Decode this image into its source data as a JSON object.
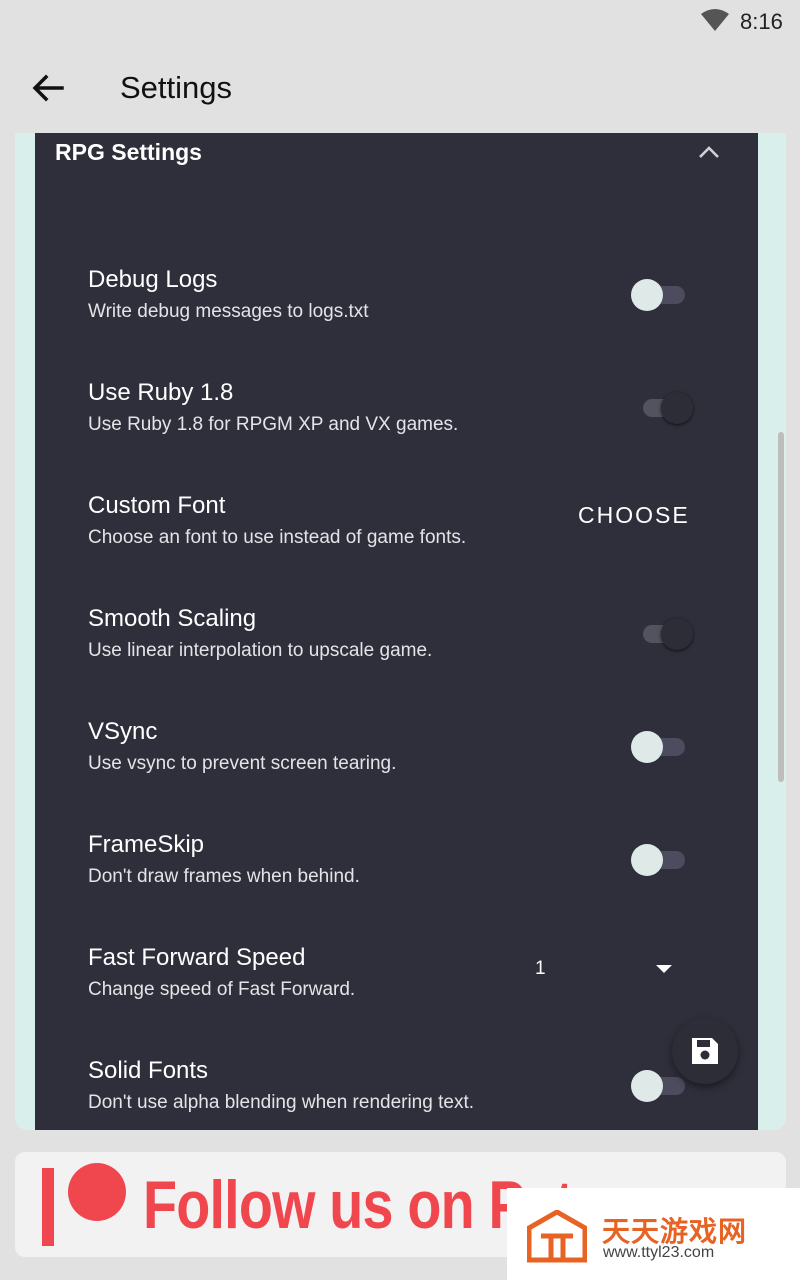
{
  "status_bar": {
    "time": "8:16",
    "wifi_icon": "wifi-icon"
  },
  "app_bar": {
    "title": "Settings",
    "back_icon": "arrow-back-icon"
  },
  "section": {
    "title": "RPG Settings",
    "collapse_icon": "chevron-up-icon"
  },
  "settings": [
    {
      "title": "Debug Logs",
      "subtitle": "Write debug messages to logs.txt",
      "control": "toggle",
      "on": false
    },
    {
      "title": "Use Ruby 1.8",
      "subtitle": "Use Ruby 1.8 for RPGM XP and VX games.",
      "control": "toggle",
      "on": true
    },
    {
      "title": "Custom Font",
      "subtitle": "Choose an font to use instead of game fonts.",
      "control": "button",
      "button_label": "CHOOSE"
    },
    {
      "title": "Smooth Scaling",
      "subtitle": "Use linear interpolation to upscale game.",
      "control": "toggle",
      "on": true
    },
    {
      "title": "VSync",
      "subtitle": "Use vsync to prevent screen tearing.",
      "control": "toggle",
      "on": false
    },
    {
      "title": "FrameSkip",
      "subtitle": "Don't draw frames when behind.",
      "control": "toggle",
      "on": false
    },
    {
      "title": "Fast Forward Speed",
      "subtitle": "Change speed of Fast Forward.",
      "control": "dropdown",
      "value": "1"
    },
    {
      "title": "Solid Fonts",
      "subtitle": "Don't use alpha blending when rendering text.",
      "control": "toggle",
      "on": false
    }
  ],
  "fab": {
    "icon": "save-icon"
  },
  "banner": {
    "text": "Follow us on Pat",
    "logo": "patreon-logo-icon"
  },
  "watermark": {
    "cn": "天天游戏网",
    "url": "www.ttyl23.com"
  },
  "colors": {
    "panel": "#2e2f3a",
    "card": "#d9efec",
    "accent": "#f0474f",
    "watermark": "#e76324"
  }
}
